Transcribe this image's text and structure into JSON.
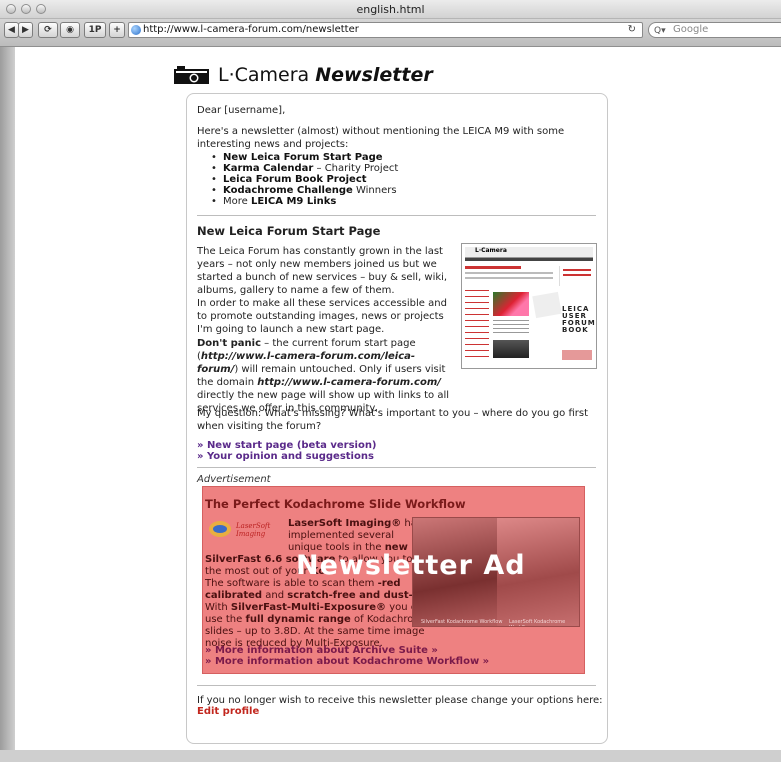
{
  "window": {
    "title": "english.html"
  },
  "toolbar": {
    "url": "http://www.l-camera-forum.com/newsletter",
    "search_placeholder": "Google",
    "btn_1p": "1P",
    "btn_plus": "+"
  },
  "header": {
    "brand_plain": "L·Camera ",
    "brand_italic": "Newsletter"
  },
  "newsletter": {
    "greeting": "Dear [username],",
    "intro": "Here's a newsletter (almost) without mentioning the LEICA M9 with some interesting news and projects:",
    "toc": [
      {
        "bold": "New Leica Forum Start Page",
        "rest": ""
      },
      {
        "bold": "Karma Calendar",
        "rest": " – Charity Project"
      },
      {
        "bold": "Leica Forum Book Project",
        "rest": ""
      },
      {
        "bold": "Kodachrome Challenge",
        "rest": " Winners"
      },
      {
        "pre": "More ",
        "bold": "LEICA M9 Links",
        "rest": ""
      }
    ],
    "section_title": "New Leica Forum Start Page",
    "p1": "The Leica Forum has constantly grown in the last years – not only new members joined us but we started a bunch of new services – buy & sell, wiki, albums, gallery to name a few of them.",
    "p2": "In order to make all these services accessible and to promote outstanding images, news or projects I'm going to launch a new start page.",
    "p3_bold": "Don't panic",
    "p3_a": " – the current forum start page (",
    "p3_url1": "http://www.l-camera-forum.com/leica-forum/",
    "p3_b": ") will remain untouched. Only if users visit the domain ",
    "p3_url2": "http://www.l-camera-forum.com/",
    "p3_c": " directly the new page will show up with links to all services we offer in this community.",
    "question": "My question: What's missing? What's important to you – where do you go first when visiting the forum?",
    "link1": "» New start page (beta version)",
    "link2": "» Your opinion and suggestions",
    "ad_label": "Advertisement",
    "ad": {
      "title": "The Perfect Kodachrome Slide Workflow",
      "logo_text_1": "LaserSoft",
      "logo_text_2": "Imaging",
      "l1_bold": "LaserSoft Imaging®",
      "l1_rest": " has",
      "l2": "implemented several",
      "l3_pre": "unique tools in the ",
      "l3_bold": "new",
      "l4_bold": "SilverFast 6.6 software",
      "l4_rest": " to allow you to get",
      "l5_pre": "the most out of your ",
      "l5_bold": "Ko",
      "l6": "The software is able to scan them ",
      "l6_bold": "-red",
      "l7_bold": "calibrated",
      "l7_mid": " and ",
      "l7_bold2": "scratch-free and dust-free.",
      "l8_pre": "With ",
      "l8_bold": "SilverFast-Multi-Exposure®",
      "l8_rest": " you can",
      "l9_pre": "use the ",
      "l9_bold": "full dynamic range",
      "l9_rest": " of Kodachrome",
      "l10": "slides – up to 3.8D. At the same time image",
      "l11": "noise is reduced by Multi-Exposure.",
      "img_caption_left": "SilverFast Kodachrome Workflow",
      "img_caption_right": "LaserSoft Kodachrome Workflow",
      "watermark": "Newsletter Ad",
      "link1": "» More information about Archive Suite »",
      "link2": "» More information about Kodachrome Workflow »"
    },
    "unsubscribe": "If you no longer wish to receive this newsletter please change your options here:",
    "edit_profile": "Edit profile"
  },
  "thumbnail": {
    "site_name": "L·Camera",
    "book_text": "LEICA USER FORUM BOOK"
  }
}
